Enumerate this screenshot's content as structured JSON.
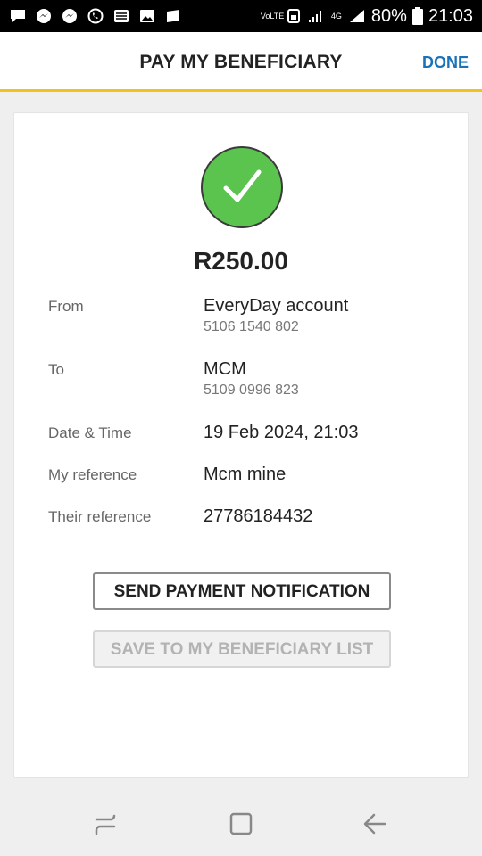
{
  "status_bar": {
    "network_label": "VoLTE",
    "signal_label": "4G",
    "battery": "80%",
    "time": "21:03"
  },
  "app_bar": {
    "title": "PAY MY BENEFICIARY",
    "done_label": "DONE"
  },
  "confirmation": {
    "amount": "R250.00",
    "from_label": "From",
    "from_account": "EveryDay account",
    "from_number": "5106 1540 802",
    "to_label": "To",
    "to_name": "MCM",
    "to_number": "5109 0996 823",
    "date_label": "Date & Time",
    "date_value": "19 Feb 2024, 21:03",
    "my_ref_label": "My reference",
    "my_ref_value": "Mcm mine",
    "their_ref_label": "Their reference",
    "their_ref_value": "27786184432"
  },
  "actions": {
    "send_notification": "SEND PAYMENT NOTIFICATION",
    "save_beneficiary": "SAVE TO MY BENEFICIARY LIST"
  },
  "colors": {
    "accent_yellow": "#f2c21a",
    "done_blue": "#1a73b8",
    "success_green": "#5ac44f"
  }
}
